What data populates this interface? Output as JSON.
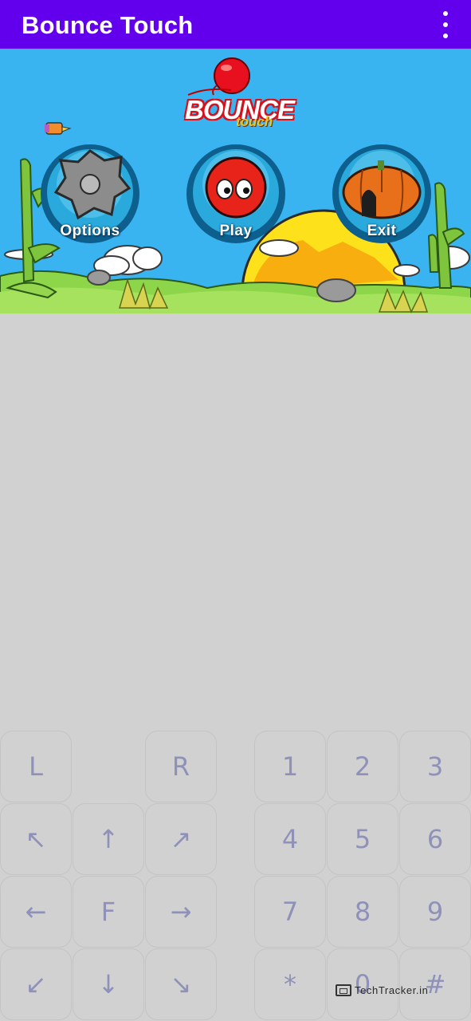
{
  "app_bar": {
    "title": "Bounce Touch",
    "menu_icon": "more-vert-icon",
    "background_color": "#6200ee"
  },
  "game_screen": {
    "logo_main": "BOUNCE",
    "logo_sub": "touch",
    "buttons": [
      {
        "label": "Options",
        "icon": "gear-icon"
      },
      {
        "label": "Play",
        "icon": "red-ball-icon"
      },
      {
        "label": "Exit",
        "icon": "pumpkin-house-icon"
      }
    ]
  },
  "keypad": {
    "left_keys": [
      "L",
      "",
      "R",
      "↖",
      "↑",
      "↗",
      "←",
      "F",
      "→",
      "↙",
      "↓",
      "↘"
    ],
    "right_keys": [
      "1",
      "2",
      "3",
      "4",
      "5",
      "6",
      "7",
      "8",
      "9",
      "*",
      "0",
      "#"
    ]
  },
  "watermark": {
    "text": "TechTracker.in"
  }
}
